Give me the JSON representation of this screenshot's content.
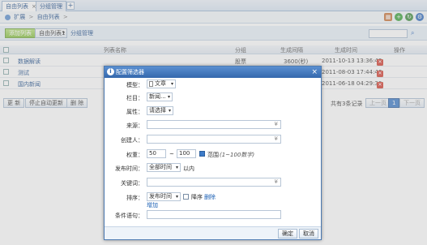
{
  "tabs": [
    {
      "label": "自由列表",
      "close": "×"
    },
    {
      "label": "分组管理"
    }
  ],
  "tab_add": "+",
  "breadcrumb": {
    "root": "扩展",
    "current": "自由列表",
    "sep": ">"
  },
  "toolbar": {
    "add_label": "添加列表",
    "group_select": "自由列表1",
    "group_manage": "分组管理"
  },
  "list": {
    "headers": [
      "列表名称",
      "分组",
      "生成间隔",
      "生成时间",
      "操作"
    ],
    "rows": [
      {
        "name": "数据解读",
        "group": "股票",
        "interval": "3600(秒)",
        "time": "2011-10-13 13:36:43"
      },
      {
        "name": "测试",
        "group": "",
        "interval": "",
        "time": "2011-08-03 17:44:46"
      },
      {
        "name": "国内新闻",
        "group": "",
        "interval": "",
        "time": "2011-06-18 04:29:30"
      }
    ]
  },
  "bottom": {
    "refresh": "更 新",
    "stop": "停止自动更新",
    "delete": "删 除",
    "total": "共有3条记录",
    "prev": "上一页",
    "page": "1",
    "next": "下一页"
  },
  "dialog": {
    "title": "配置筛选器",
    "close": "×",
    "fields": {
      "model_label": "模型：",
      "model_value": "文章",
      "column_label": "栏目：",
      "column_value": "新闻...",
      "attr_label": "属性：",
      "attr_value": "请选择",
      "source_label": "来源：",
      "creator_label": "创建人：",
      "weight_label": "权重：",
      "weight_from": "50",
      "weight_sep": "~",
      "weight_to": "100",
      "range_label": "范围",
      "range_hint": "(1~100数字)",
      "pubtime_label": "发布时间：",
      "pubtime_value": "全部时间",
      "pubtime_suffix": "以内",
      "keyword_label": "关键词：",
      "sort_label": "排序：",
      "sort_value": "发布时间",
      "sort_desc": "降序",
      "sort_delete": "删除",
      "sort_add": "增加",
      "condition_label": "条件语句："
    },
    "ok": "确定",
    "cancel": "取消"
  }
}
